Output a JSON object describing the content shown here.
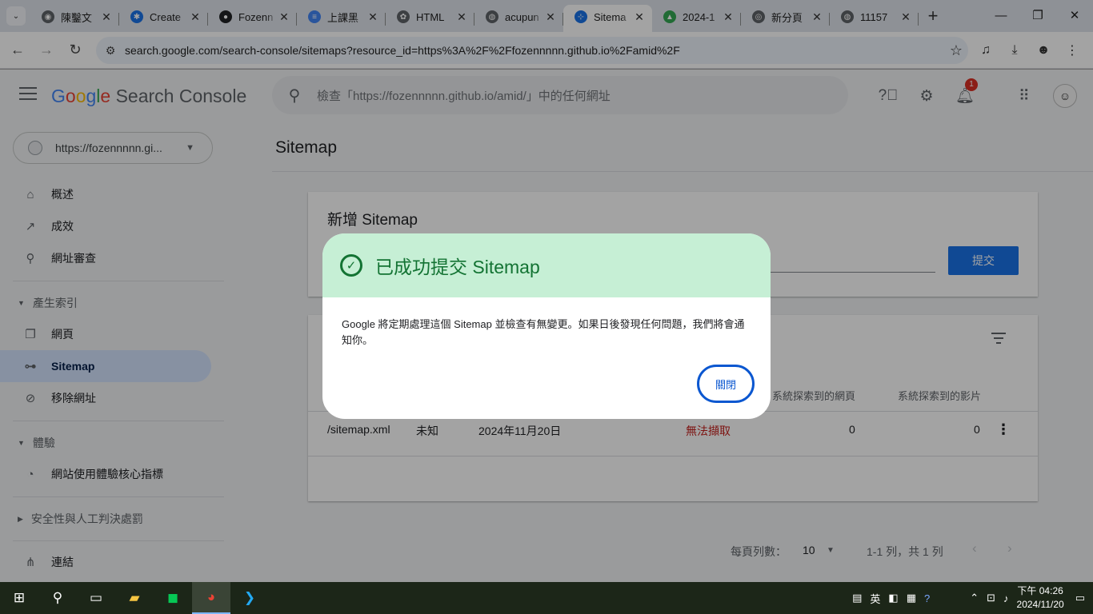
{
  "browser": {
    "tabs": [
      {
        "title": "陳鑿文",
        "fav_color": "#5f6368",
        "fav_glyph": "◉"
      },
      {
        "title": "Create",
        "fav_color": "#1a73e8",
        "fav_glyph": "✱"
      },
      {
        "title": "Fozenn",
        "fav_color": "#202124",
        "fav_glyph": "●"
      },
      {
        "title": "上課黑",
        "fav_color": "#4285f4",
        "fav_glyph": "≡"
      },
      {
        "title": "HTML",
        "fav_color": "#5f6368",
        "fav_glyph": "✿"
      },
      {
        "title": "acupun",
        "fav_color": "#5f6368",
        "fav_glyph": "◍"
      },
      {
        "title": "Sitema",
        "fav_color": "#1a73e8",
        "fav_glyph": "⊹",
        "active": true
      },
      {
        "title": "2024-1",
        "fav_color": "#34a853",
        "fav_glyph": "▲"
      },
      {
        "title": "新分頁",
        "fav_color": "#5f6368",
        "fav_glyph": "◎"
      },
      {
        "title": "11157",
        "fav_color": "#5f6368",
        "fav_glyph": "◍"
      }
    ],
    "new_tab": "+",
    "url": "search.google.com/search-console/sitemaps?resource_id=https%3A%2F%2Ffozennnnn.github.io%2Famid%2F"
  },
  "app": {
    "brand_colored": [
      "G",
      "o",
      "o",
      "g",
      "l",
      "e"
    ],
    "product": "Search Console",
    "search_placeholder": "檢查「https://fozennnnn.github.io/amid/」中的任何網址",
    "notification_count": "1",
    "property": "https://fozennnnn.gi...",
    "nav": {
      "overview": "概述",
      "performance": "成效",
      "url_inspection": "網址審查",
      "indexing_section": "產生索引",
      "pages": "網頁",
      "sitemaps": "Sitemap",
      "removals": "移除網址",
      "experience_section": "體驗",
      "core_web_vitals": "網站使用體驗核心指標",
      "security_section": "安全性與人工判決處罰",
      "links": "連結"
    }
  },
  "main": {
    "page_title": "Sitemap",
    "add_card_title": "新增 Sitemap",
    "submit_label": "提交",
    "columns": {
      "discovered_pages": "系統探索到的網頁",
      "discovered_videos": "系統探索到的影片"
    },
    "row": {
      "sitemap": "/sitemap.xml",
      "type": "未知",
      "submitted": "2024年11月20日",
      "status": "無法擷取",
      "pages": "0",
      "videos": "0"
    },
    "pager": {
      "rows_label": "每頁列數：",
      "rows_value": "10",
      "range": "1-1 列，共 1 列"
    }
  },
  "dialog": {
    "title": "已成功提交 Sitemap",
    "body": "Google 將定期處理這個 Sitemap 並檢查有無變更。如果日後發現任何問題，我們將會通知你。",
    "close_label": "關閉"
  },
  "taskbar": {
    "ime": "英",
    "time": "下午 04:26",
    "date": "2024/11/20"
  }
}
